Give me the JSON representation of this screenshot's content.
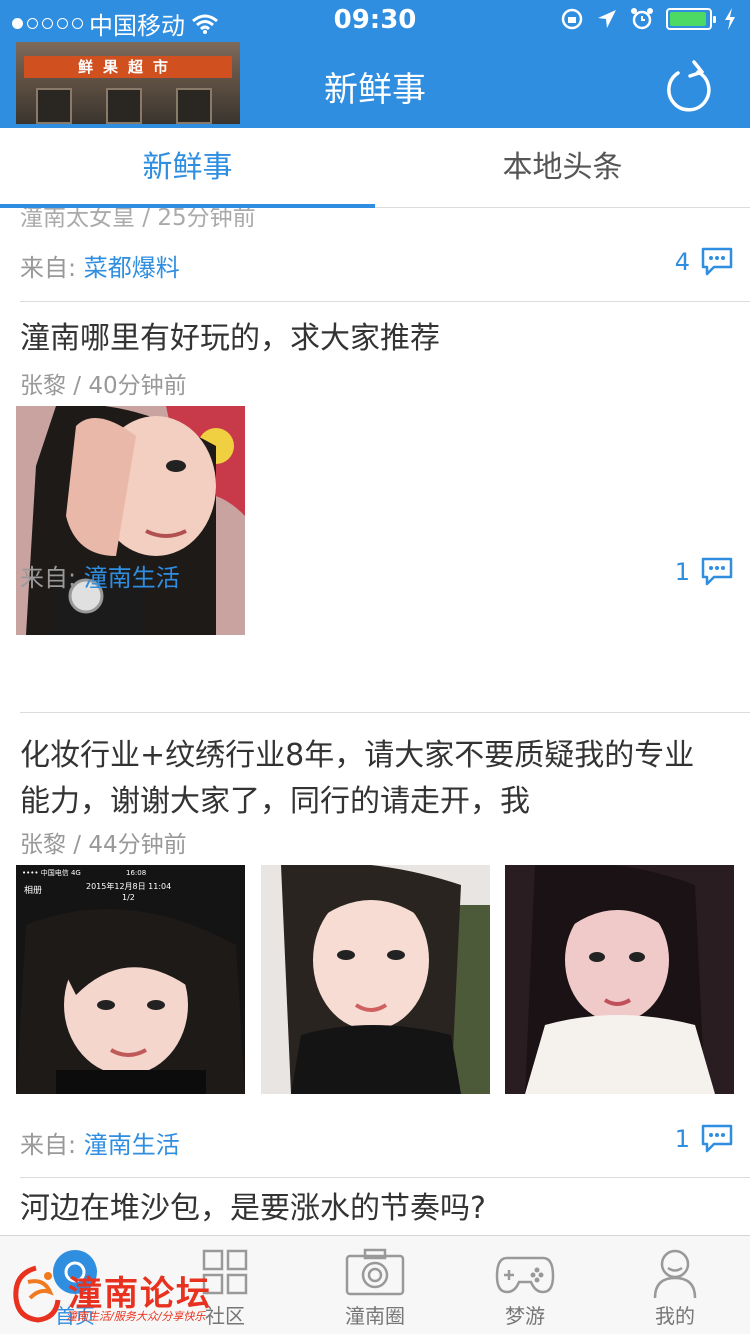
{
  "status_bar": {
    "carrier": "中国移动",
    "time": "09:30"
  },
  "header": {
    "title": "新鲜事",
    "logo_text": "鲜果超市"
  },
  "tabs": [
    {
      "label": "新鲜事",
      "active": true
    },
    {
      "label": "本地头条",
      "active": false
    }
  ],
  "feed": {
    "partial_post": {
      "meta": "潼南太女皇 / 25分钟前",
      "from_label": "来自:",
      "source": "菜都爆料",
      "comments": "4"
    },
    "posts": [
      {
        "title": "潼南哪里有好玩的，求大家推荐",
        "author_time": "张黎 / 40分钟前",
        "from_label": "来自:",
        "source": "潼南生活",
        "comments": "1"
      },
      {
        "title": "化妆行业+纹绣行业8年，请大家不要质疑我的专业能力，谢谢大家了，同行的请走开，我",
        "author_time": "张黎 / 44分钟前",
        "from_label": "来自:",
        "source": "潼南生活",
        "comments": "1",
        "photo_text": {
          "carrier": "•••• 中国电信 4G",
          "time": "16:08",
          "back": "相册",
          "date": "2015年12月8日 11:04",
          "page": "1/2"
        }
      },
      {
        "title": "河边在堆沙包，是要涨水的节奏吗?"
      }
    ]
  },
  "tabbar": [
    {
      "label": "首页",
      "icon": "home-icon",
      "active": true
    },
    {
      "label": "社区",
      "icon": "grid-icon",
      "active": false
    },
    {
      "label": "潼南圈",
      "icon": "camera-icon",
      "active": false
    },
    {
      "label": "梦游",
      "icon": "gamepad-icon",
      "active": false
    },
    {
      "label": "我的",
      "icon": "user-icon",
      "active": false
    }
  ],
  "watermark": {
    "title": "潼南论坛",
    "subtitle": "潼南生活/服务大众/分享快乐"
  },
  "colors": {
    "primary": "#2f8ee0",
    "watermark": "#e8321f"
  }
}
